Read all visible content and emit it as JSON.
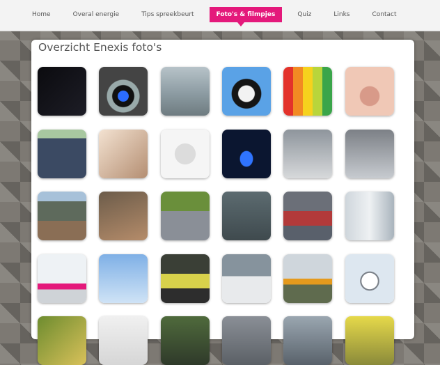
{
  "nav": {
    "items": [
      {
        "label": "Home"
      },
      {
        "label": "Overal energie"
      },
      {
        "label": "Tips spreekbeurt"
      },
      {
        "label": "Foto's & filmpjes",
        "active": true
      },
      {
        "label": "Quiz"
      },
      {
        "label": "Links"
      },
      {
        "label": "Contact"
      }
    ],
    "accent": "#e4197b"
  },
  "page": {
    "title": "Overzicht Enexis foto's"
  },
  "gallery": {
    "rows": [
      [
        {
          "name": "night-lights-photo",
          "bg": "linear-gradient(135deg,#0b0b0f,#1d1d26)"
        },
        {
          "name": "gas-burner-photo",
          "bg": "radial-gradient(circle at 50% 60%,#2b6cff 0 14%,#111 15% 28%,#9aa 30% 42%,#444 44% 100%)"
        },
        {
          "name": "wading-water-photo",
          "bg": "linear-gradient(180deg,#b7c3c9 0%,#8c9ba2 55%,#6e7b80 100%)"
        },
        {
          "name": "cow-photo",
          "bg": "radial-gradient(circle at 50% 55%,#f2f2f2 0 22%,#151515 24% 40%,#5aa2e6 42% 100%)"
        },
        {
          "name": "energy-labels-photo",
          "bg": "linear-gradient(90deg,#e3322b 0 20%,#f28a23 20% 40%,#f6d21d 40% 60%,#b9d53b 60% 80%,#3aa54a 80% 100%)"
        },
        {
          "name": "nose-photo",
          "bg": "radial-gradient(circle at 50% 60%,#d89a89 0 25%,#f0c8b6 27% 100%)"
        }
      ],
      [
        {
          "name": "solar-panels-photo",
          "bg": "linear-gradient(180deg,#a8c8a0 0 18%,#3b4a63 18% 100%)"
        },
        {
          "name": "pouring-water-photo",
          "bg": "linear-gradient(135deg,#f3e2d1,#b48e72)"
        },
        {
          "name": "power-socket-photo",
          "bg": "radial-gradient(circle at 50% 50%,#dcdcdc 0 30%,#f5f5f5 31% 100%)"
        },
        {
          "name": "gas-flame-photo",
          "bg": "radial-gradient(ellipse at 50% 60%,#2f74ff 0 18%,#0b1630 20% 100%)"
        },
        {
          "name": "gas-meter-photo",
          "bg": "linear-gradient(180deg,#8e959c,#d7d9db)"
        },
        {
          "name": "meter-installation-photo",
          "bg": "linear-gradient(180deg,#7c8086,#c7cbd0)"
        }
      ],
      [
        {
          "name": "trench-work-photo",
          "bg": "linear-gradient(180deg,#a7c1d9 0 20%,#5e6a5c 20% 60%,#8a6e55 60% 100%)"
        },
        {
          "name": "cables-dig-photo",
          "bg": "linear-gradient(160deg,#6c5c4a,#b58c6a)"
        },
        {
          "name": "street-workers-photo",
          "bg": "linear-gradient(180deg,#6a8f3b 0 40%,#8a8f97 40% 100%)"
        },
        {
          "name": "substation-door-photo",
          "bg": "linear-gradient(180deg,#5c6b70,#3f4a4e)"
        },
        {
          "name": "transformer-photo",
          "bg": "linear-gradient(180deg,#6b6f78 0 40%,#b23a3a 40% 70%,#59606b 70% 100%)"
        },
        {
          "name": "alley-photo",
          "bg": "linear-gradient(90deg,#cfd6dc,#eef1f3,#a9b4bd)"
        }
      ],
      [
        {
          "name": "enexis-van-photo",
          "bg": "linear-gradient(180deg,#eef2f5 0 60%,#e4197b 60% 72%,#cfd3d7 72% 100%)"
        },
        {
          "name": "power-pylon-photo",
          "bg": "linear-gradient(180deg,#7fb0e6,#cfe3f6)"
        },
        {
          "name": "workers-map-photo",
          "bg": "linear-gradient(180deg,#3a3f36 0 40%,#d8d24b 40% 70%,#2d2d2d 70% 100%)"
        },
        {
          "name": "service-van-photo",
          "bg": "linear-gradient(180deg,#86939d 0 45%,#e8eaec 45% 100%)"
        },
        {
          "name": "windmill-excavator-photo",
          "bg": "linear-gradient(180deg,#cfd6dc 0 50%,#e59a1d 50% 62%,#5f6b4e 62% 100%)"
        },
        {
          "name": "stopwatch-photo",
          "bg": "radial-gradient(circle at 50% 55%,#ffffff 0 22%,#7a8088 23% 26%,#dde7f0 27% 100%)"
        }
      ],
      [
        {
          "name": "fruit-photo",
          "bg": "linear-gradient(135deg,#6d8c2f,#d9c15a)"
        },
        {
          "name": "device-photo",
          "bg": "linear-gradient(180deg,#f0f0f0,#d6d6d6)"
        },
        {
          "name": "dog-photo",
          "bg": "linear-gradient(180deg,#4f6a3c,#2f3a2a)"
        },
        {
          "name": "pipe-photo",
          "bg": "linear-gradient(180deg,#8a8f96,#5b6066)"
        },
        {
          "name": "road-photo",
          "bg": "linear-gradient(180deg,#9aa6b0,#59626b)"
        },
        {
          "name": "person-yellow-photo",
          "bg": "linear-gradient(180deg,#e6d94a,#8a8a3a)"
        }
      ]
    ]
  }
}
